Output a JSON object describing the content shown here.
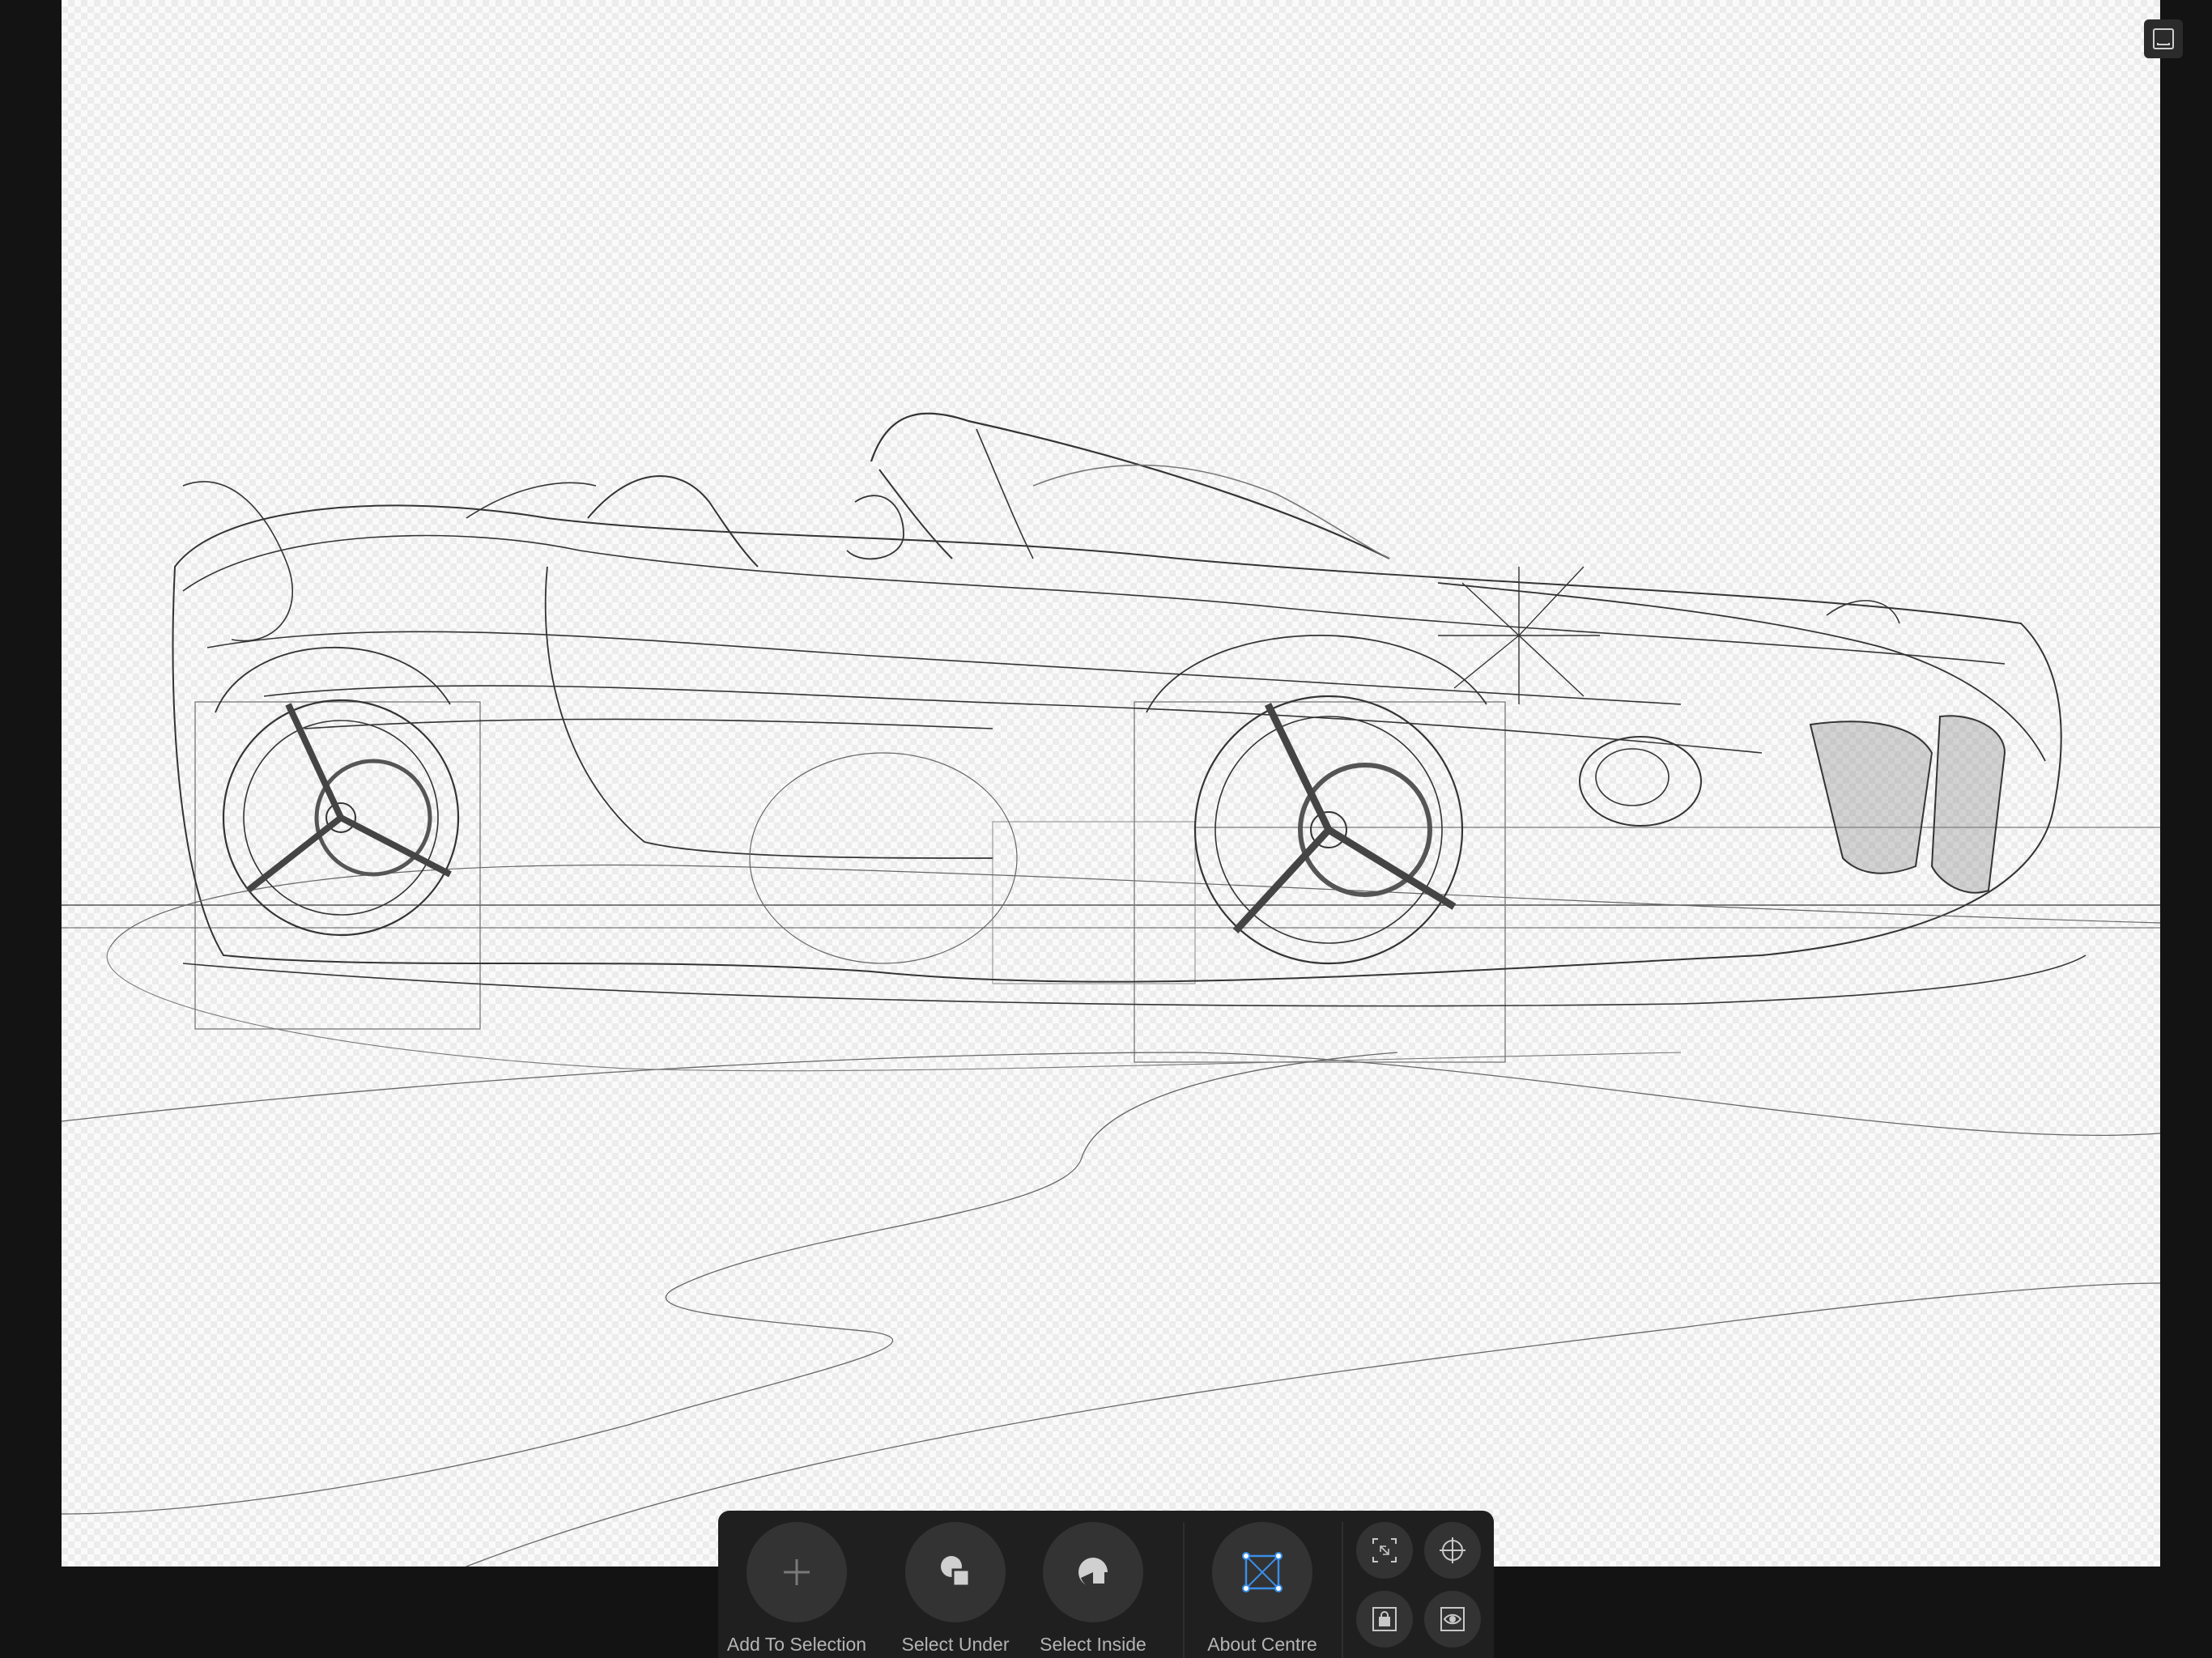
{
  "toolbar": {
    "add_to_selection": "Add To Selection",
    "select_under": "Select Under",
    "select_inside": "Select Inside",
    "about_centre": "About Centre",
    "mini_icons": [
      "bounding-box-icon",
      "target-icon",
      "lock-children-icon",
      "view-icon"
    ]
  },
  "colors": {
    "background": "#131313",
    "toolbar": "#1f1f1f",
    "button": "#333333",
    "label": "#b4b4b4",
    "accent": "#3a8ee8"
  }
}
